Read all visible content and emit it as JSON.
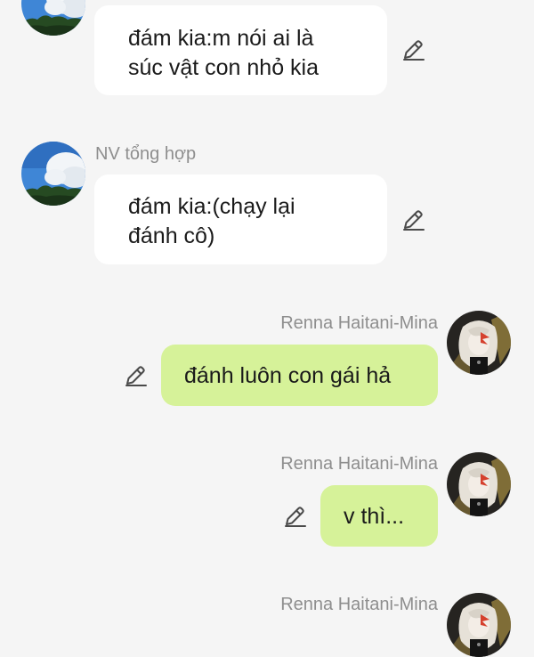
{
  "messages": [
    {
      "sender": "",
      "text_lines": [
        "đám kia:m nói ai là",
        "súc vật con nhỏ kia"
      ]
    },
    {
      "sender": "NV tổng hợp",
      "text_lines": [
        "đám kia:(chạy lại",
        "đánh cô)"
      ]
    },
    {
      "sender": "Renna Haitani-Mina",
      "text_lines": [
        "đánh luôn con gái hả"
      ]
    },
    {
      "sender": "Renna Haitani-Mina",
      "text_lines": [
        "v thì..."
      ]
    },
    {
      "sender": "Renna Haitani-Mina",
      "text_lines": []
    }
  ],
  "icons": {
    "edit": "pencil-edit-icon",
    "avatar_in": "sky-avatar",
    "avatar_out": "anime-avatar"
  },
  "colors": {
    "background": "#f5f5f5",
    "bubble_in": "#ffffff",
    "bubble_out": "#d6f299",
    "sender_name": "#8e8e8e"
  }
}
